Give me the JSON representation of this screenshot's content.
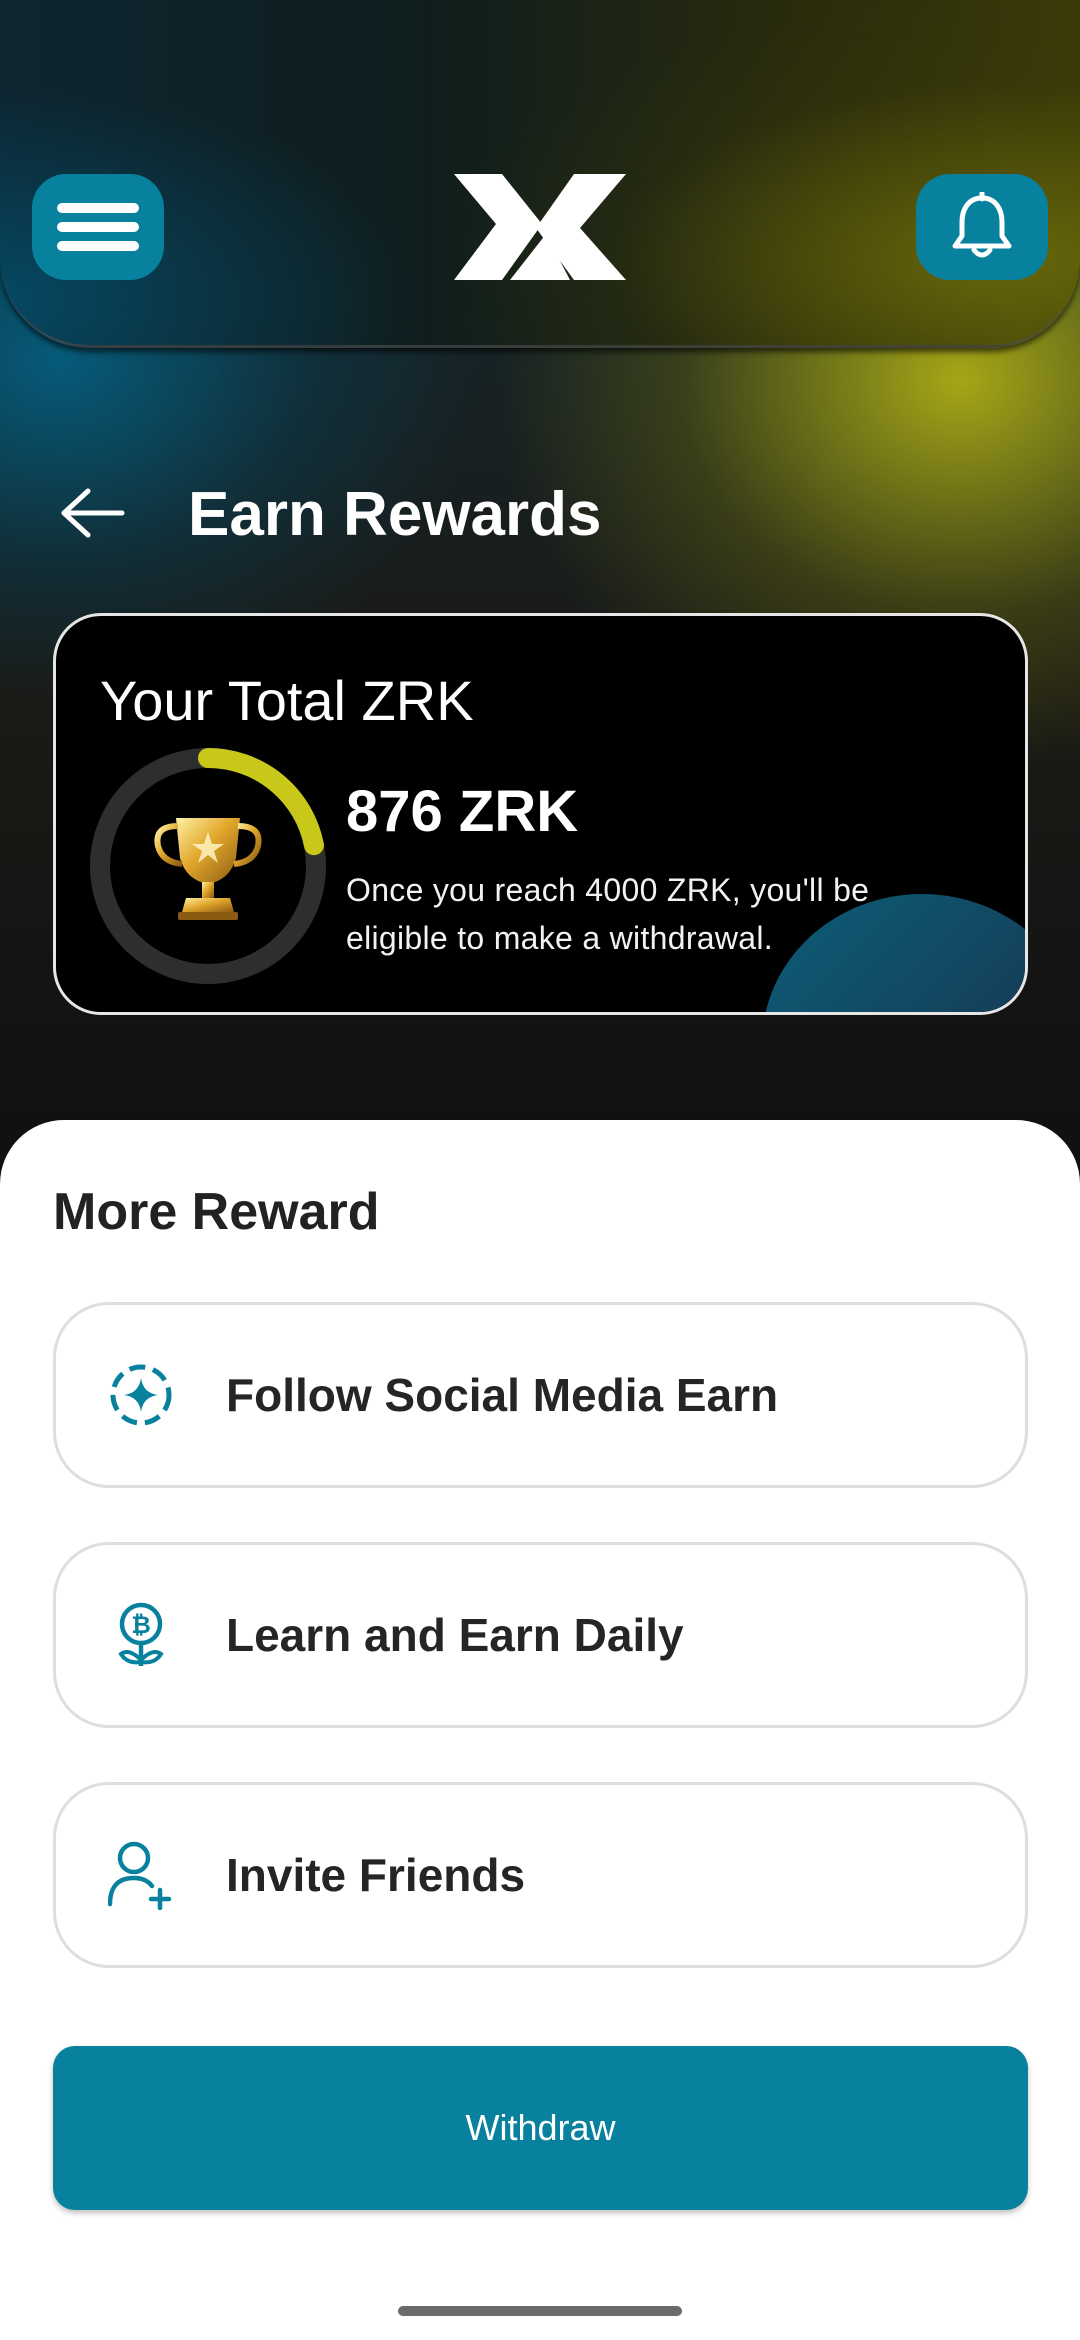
{
  "header": {
    "menu_icon": "hamburger-menu-icon",
    "logo_icon": "zk-logo",
    "bell_icon": "bell-icon"
  },
  "page": {
    "title": "Earn Rewards",
    "back_icon": "arrow-left-icon"
  },
  "total_card": {
    "title": "Your Total ZRK",
    "amount": "876 ZRK",
    "note": "Once you reach 4000 ZRK, you'll be eligible to make a withdrawal.",
    "progress_fraction": 0.219,
    "progress_color": "#c8c81a",
    "trophy_icon": "trophy-icon"
  },
  "more_reward": {
    "title": "More Reward",
    "items": [
      {
        "label": "Follow Social Media Earn",
        "icon": "sparkle-circle-icon"
      },
      {
        "label": "Learn and Earn Daily",
        "icon": "bitcoin-plant-icon"
      },
      {
        "label": "Invite Friends",
        "icon": "add-user-icon"
      }
    ]
  },
  "withdraw_button": {
    "label": "Withdraw"
  },
  "colors": {
    "accent": "#07819e",
    "card_background": "#000000",
    "sheet_background": "#ffffff"
  }
}
